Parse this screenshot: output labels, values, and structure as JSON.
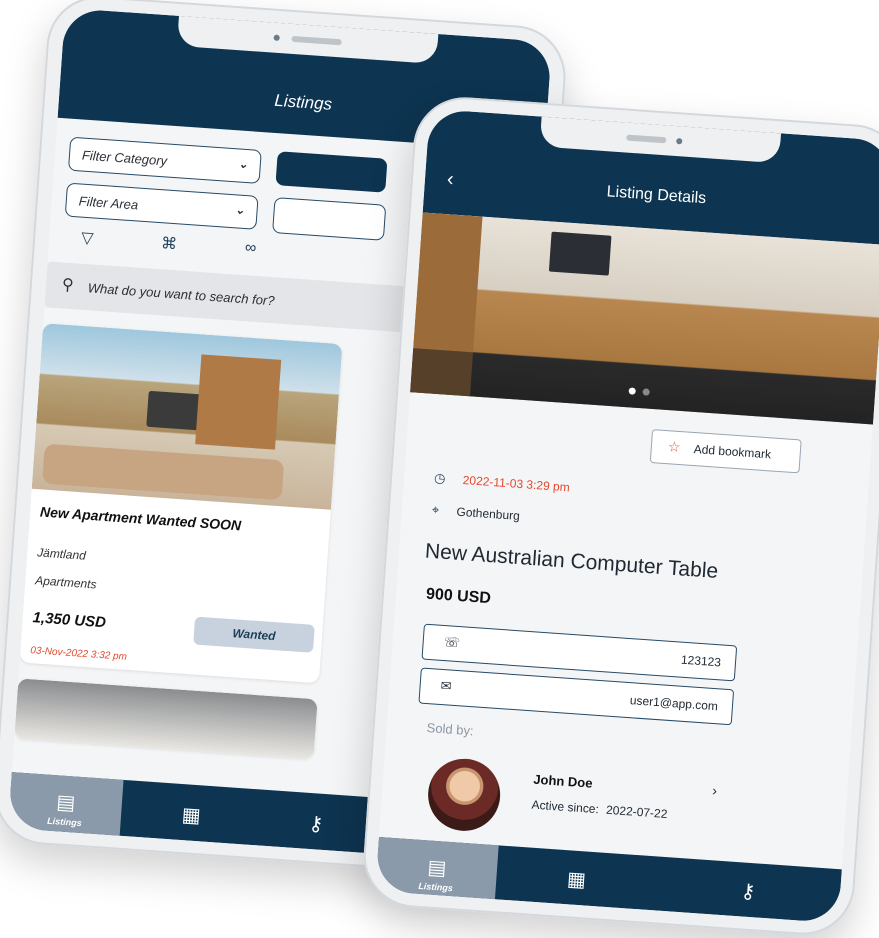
{
  "left": {
    "title": "Listings",
    "filter_category": "Filter Category",
    "filter_area": "Filter Area",
    "search_placeholder": "What do you want to search for?",
    "card": {
      "title": "New Apartment Wanted SOON",
      "area": "Jämtland",
      "category": "Apartments",
      "price": "1,350 USD",
      "badge": "Wanted",
      "date": "03-Nov-2022 3:32 pm"
    },
    "tabs": {
      "listings": "Listings"
    }
  },
  "right": {
    "title": "Listing Details",
    "bookmark_label": "Add bookmark",
    "date": "2022-11-03 3:29 pm",
    "location": "Gothenburg",
    "item_title": "New Australian Computer Table",
    "price": "900 USD",
    "phone": "123123",
    "email": "user1@app.com",
    "sold_by_label": "Sold by:",
    "seller_name": "John Doe",
    "active_since_label": "Active since:",
    "active_since": "2022-07-22",
    "tabs": {
      "listings": "Listings"
    }
  },
  "colors": {
    "navy": "#0d3450",
    "accent_red": "#e2492f",
    "active_tab": "#8a9aaa"
  },
  "icons": [
    "chevron-down-icon",
    "filter-icon",
    "map-icon",
    "binoculars-icon",
    "search-icon",
    "list-icon",
    "newspaper-icon",
    "key-icon",
    "back-icon",
    "star-icon",
    "clock-icon",
    "location-pin-icon",
    "phone-icon",
    "mail-icon",
    "chevron-right-icon"
  ]
}
